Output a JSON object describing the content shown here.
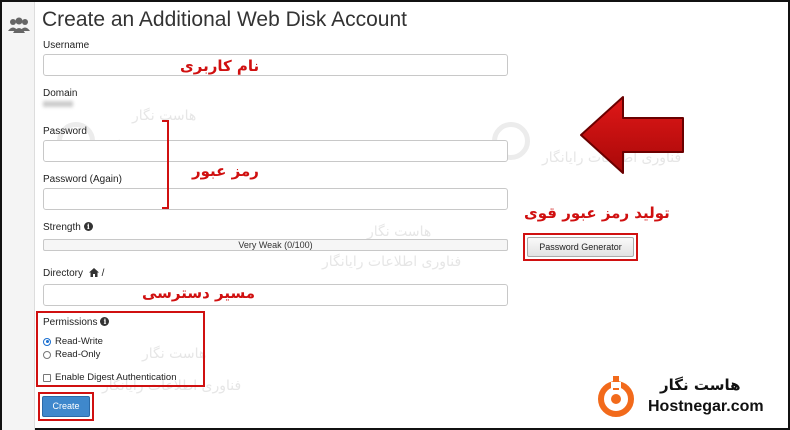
{
  "page": {
    "title": "Create an Additional Web Disk Account"
  },
  "form": {
    "username_label": "Username",
    "username_value": "",
    "at_addon": "@",
    "domain_label": "Domain",
    "password_label": "Password",
    "password_again_label": "Password (Again)",
    "strength_label": "Strength",
    "strength_text": "Very Weak (0/100)",
    "strength_level": 0,
    "password_generator_label": "Password Generator",
    "directory_label": "Directory",
    "directory_suffix": "/",
    "directory_value": "",
    "permissions_label": "Permissions",
    "permissions_options": [
      {
        "label": "Read-Write",
        "selected": true
      },
      {
        "label": "Read-Only",
        "selected": false
      }
    ],
    "digest_auth_label": "Enable Digest Authentication",
    "digest_auth_checked": false,
    "create_label": "Create"
  },
  "annotations": {
    "username": "نام کاربری",
    "password": "رمز عبور",
    "generator": "تولید رمز عبور قوی",
    "directory": "مسیر دسترسی",
    "color": "#d01010"
  },
  "watermark": {
    "name": "هاست نگار",
    "tagline": "فناوری اطلاعات رایانگار"
  },
  "logo": {
    "name_fa": "هاست نگار",
    "name_en": "Hostnegar.com",
    "color": "#f26a1b"
  },
  "icons": {
    "sidebar": "users-icon",
    "info": "info-icon",
    "home": "home-icon",
    "arrow": "left-arrow-icon"
  }
}
